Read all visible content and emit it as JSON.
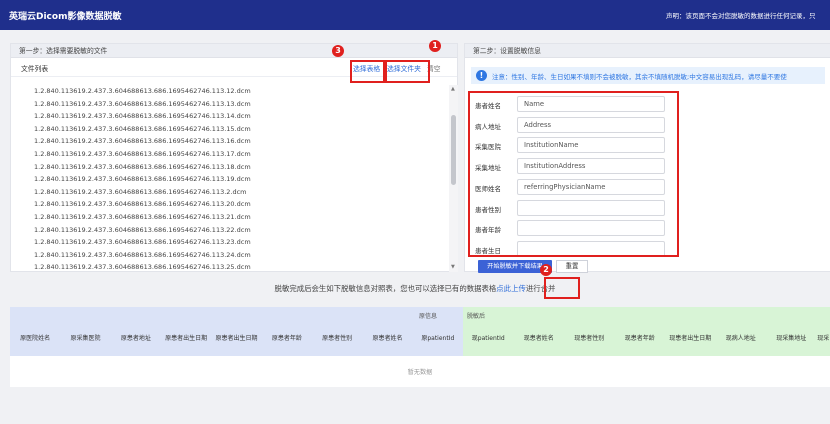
{
  "header": {
    "title": "英瑞云Dicom影像数据脱敏",
    "notice": "声明：该页面不会对您脱敏的数据进行任何记录，只"
  },
  "step1": {
    "title": "第一步：选择需要脱敏的文件",
    "list_title": "文件列表",
    "select_table": "选择表格",
    "select_folder": "选择文件夹",
    "clear": "清空",
    "files": [
      "1.2.840.113619.2.437.3.604688613.686.1695462746.113.12.dcm",
      "1.2.840.113619.2.437.3.604688613.686.1695462746.113.13.dcm",
      "1.2.840.113619.2.437.3.604688613.686.1695462746.113.14.dcm",
      "1.2.840.113619.2.437.3.604688613.686.1695462746.113.15.dcm",
      "1.2.840.113619.2.437.3.604688613.686.1695462746.113.16.dcm",
      "1.2.840.113619.2.437.3.604688613.686.1695462746.113.17.dcm",
      "1.2.840.113619.2.437.3.604688613.686.1695462746.113.18.dcm",
      "1.2.840.113619.2.437.3.604688613.686.1695462746.113.19.dcm",
      "1.2.840.113619.2.437.3.604688613.686.1695462746.113.2.dcm",
      "1.2.840.113619.2.437.3.604688613.686.1695462746.113.20.dcm",
      "1.2.840.113619.2.437.3.604688613.686.1695462746.113.21.dcm",
      "1.2.840.113619.2.437.3.604688613.686.1695462746.113.22.dcm",
      "1.2.840.113619.2.437.3.604688613.686.1695462746.113.23.dcm",
      "1.2.840.113619.2.437.3.604688613.686.1695462746.113.24.dcm",
      "1.2.840.113619.2.437.3.604688613.686.1695462746.113.25.dcm"
    ]
  },
  "step2": {
    "title": "第二步：设置脱敏信息",
    "info": "注意：性别、年龄、生日如果不填则不会被脱敏，其余不填随机脱敏;中文容易出现乱码，请尽量不要使",
    "fields": [
      {
        "label": "患者姓名",
        "value": "Name"
      },
      {
        "label": "病人地址",
        "value": "Address"
      },
      {
        "label": "采集医院",
        "value": "InstitutionName"
      },
      {
        "label": "采集地址",
        "value": "InstitutionAddress"
      },
      {
        "label": "医师姓名",
        "value": "referringPhysicianName"
      },
      {
        "label": "患者性别",
        "value": ""
      },
      {
        "label": "患者年龄",
        "value": ""
      },
      {
        "label": "患者生日",
        "value": ""
      }
    ],
    "start_button": "开始脱敏并下载结果",
    "reset_button": "重置"
  },
  "merge": {
    "before": "脱敏完成后会生如下脱敏信息对照表，您也可以选择已有的数据表格",
    "link": "点此上传",
    "after": "进行合并"
  },
  "result_table": {
    "group_original": "原信息",
    "group_after": "脱敏后",
    "columns_original": [
      "原医院姓名",
      "原采集医院",
      "原患者地址",
      "原患者出生日期",
      "原患者出生日期",
      "原患者年龄",
      "原患者性别",
      "原患者姓名",
      "原patientId"
    ],
    "columns_after": [
      "现patientId",
      "现患者姓名",
      "现患者性别",
      "现患者年龄",
      "现患者出生日期",
      "现病人地址",
      "现采集地址",
      "现采"
    ],
    "empty_text": "暂无数据"
  },
  "annotations": {
    "badge_1": "1",
    "badge_2": "2",
    "badge_3": "3",
    "color": "#e0201e"
  },
  "colors": {
    "header_bg": "#1f2f8c",
    "primary": "#3b62d6",
    "link": "#2c6bd8",
    "original_group": "#dbe3f7",
    "after_group": "#d8f4d6"
  }
}
